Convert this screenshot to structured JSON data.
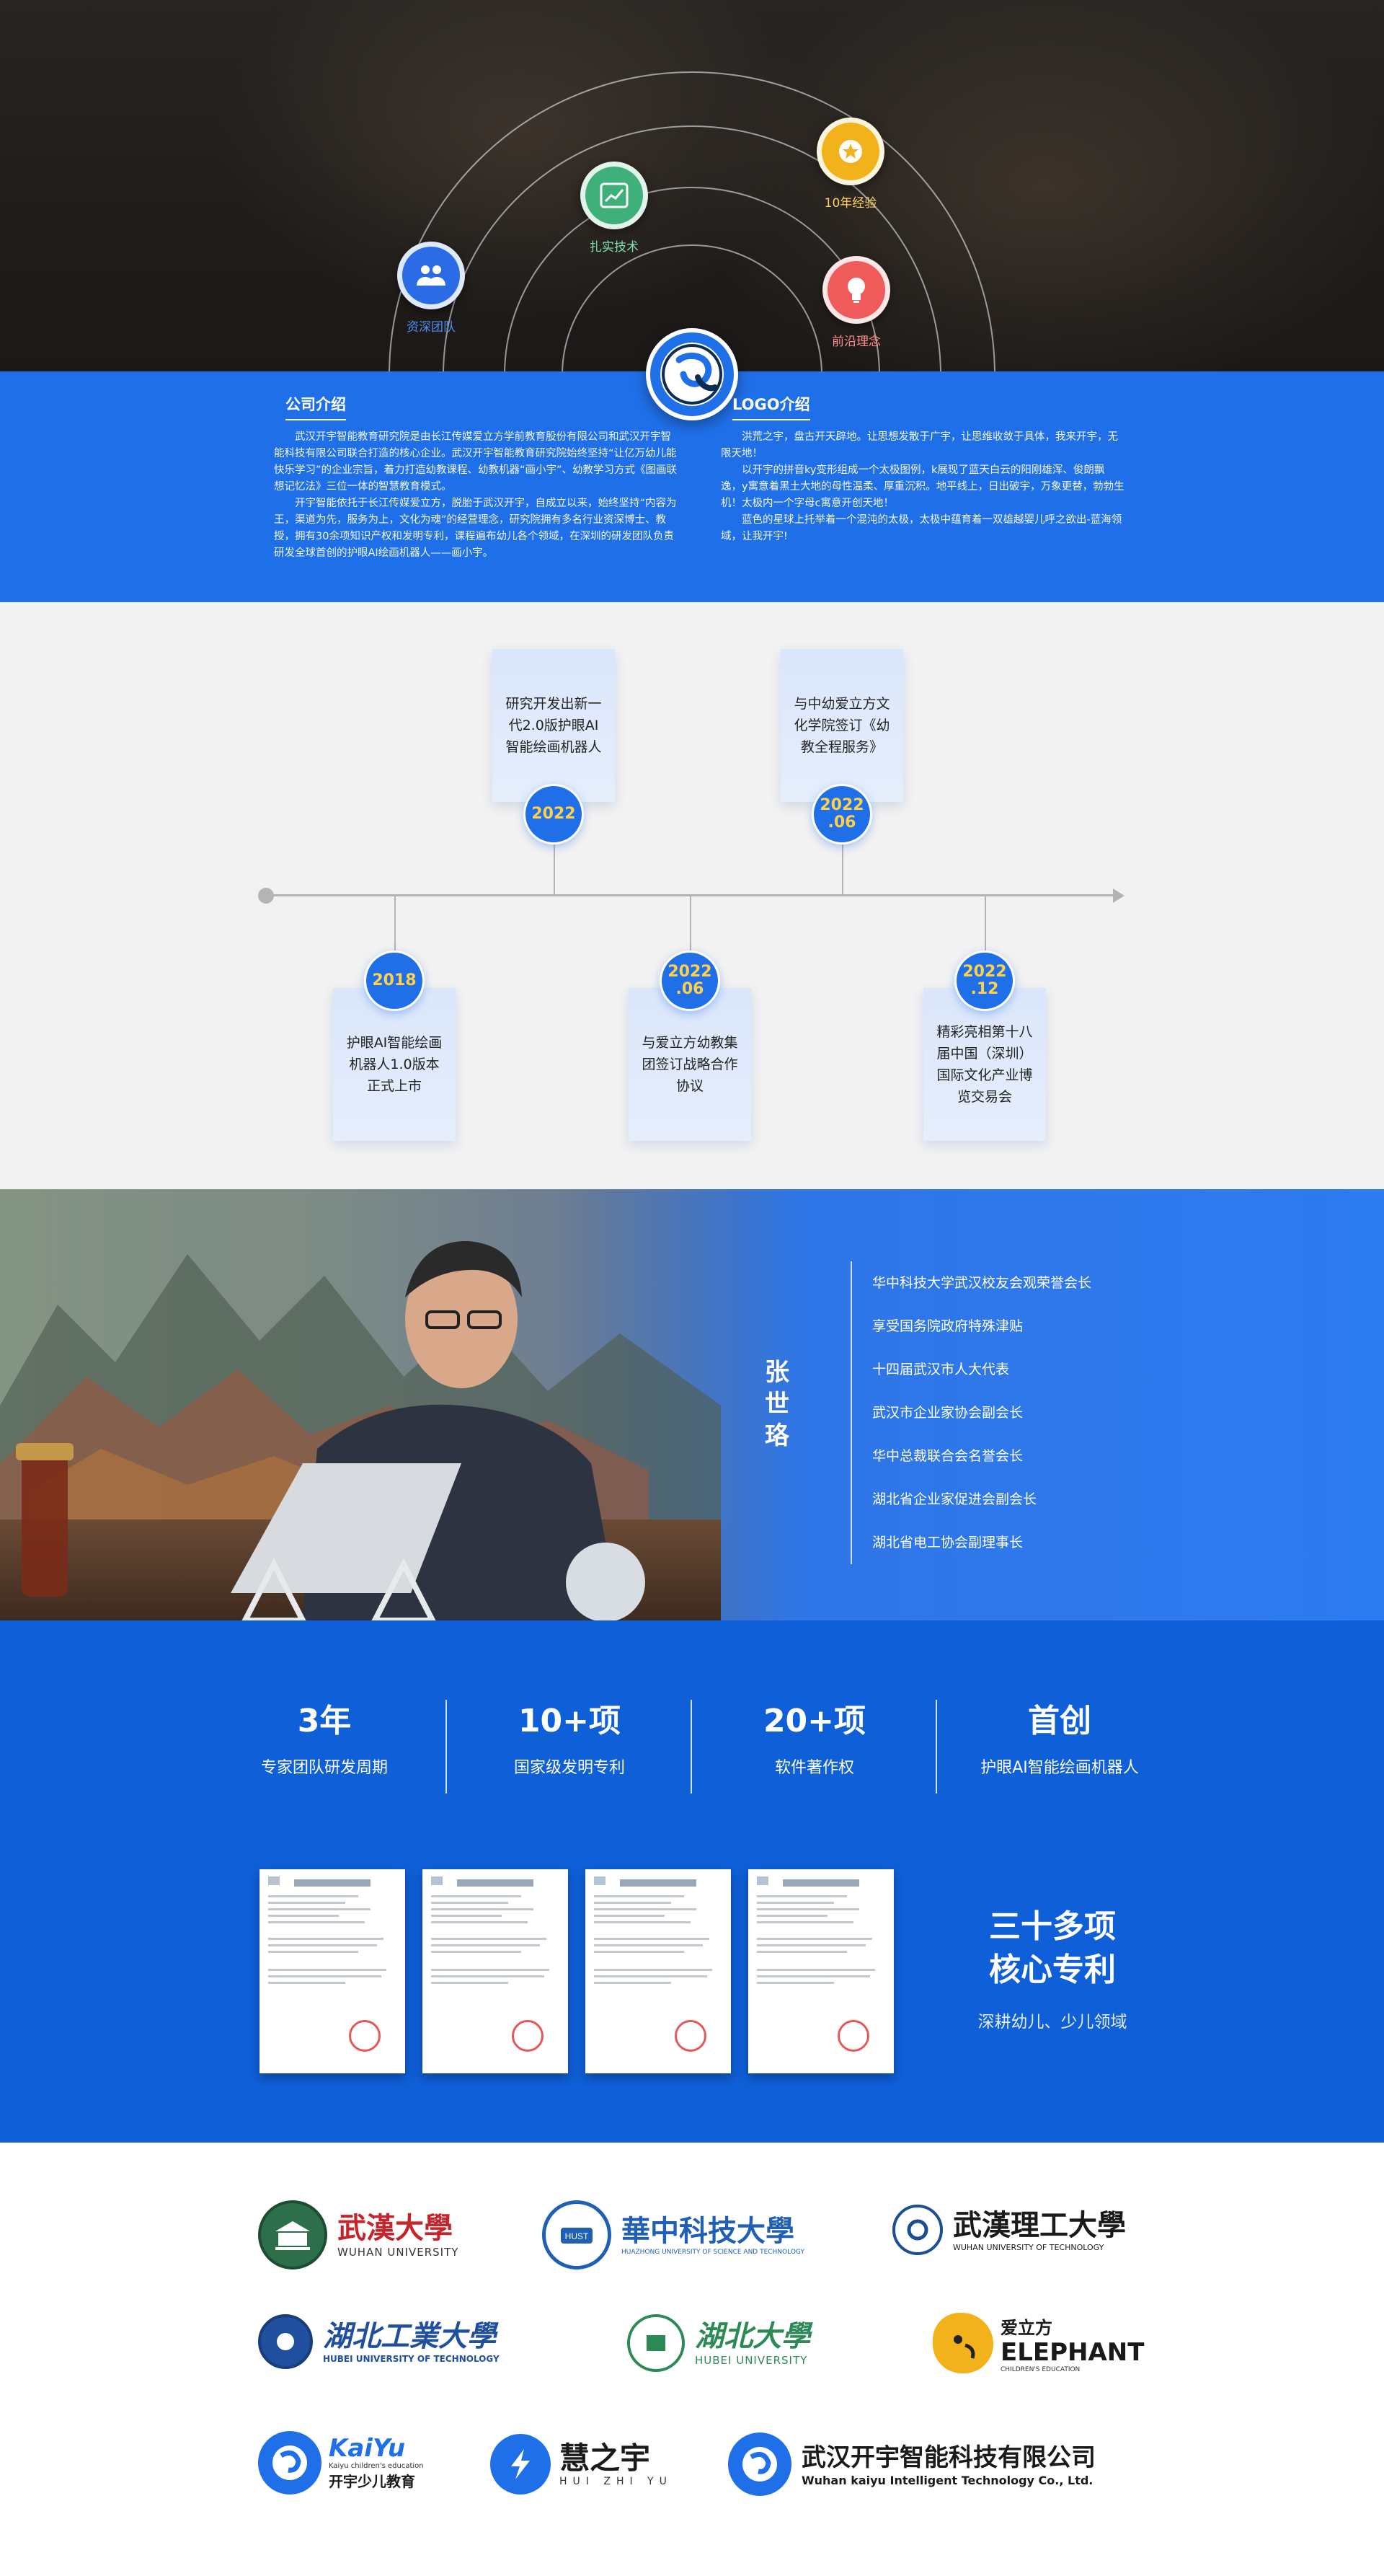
{
  "hero": {
    "features": [
      {
        "label": "资深团队",
        "icon": "team-icon"
      },
      {
        "label": "扎实技术",
        "icon": "chart-icon"
      },
      {
        "label": "10年经验",
        "icon": "star-medal-icon"
      },
      {
        "label": "前沿理念",
        "icon": "lightbulb-icon"
      }
    ]
  },
  "intro": {
    "company": {
      "title": "公司介绍",
      "p1": "武汉开宇智能教育研究院是由长江传媒爱立方学前教育股份有限公司和武汉开宇智能科技有限公司联合打造的核心企业。武汉开宇智能教育研究院始终坚持“让亿万幼儿能快乐学习”的企业宗旨，着力打造幼教课程、幼教机器“画小宇”、幼教学习方式《图画联想记忆法》三位一体的智慧教育模式。",
      "p2": "开宇智能依托于长江传媒爱立方，脱胎于武汉开宇，自成立以来，始终坚持“内容为王，渠道为先，服务为上，文化为魂”的经营理念，研究院拥有多名行业资深博士、教授，拥有30余项知识产权和发明专利，课程遍布幼儿各个领域，在深圳的研发团队负责研发全球首创的护眼AI绘画机器人——画小宇。"
    },
    "logo": {
      "title": "LOGO介绍",
      "p1": "洪荒之宇，盘古开天辟地。让思想发散于广宇，让思维收敛于具体，我来开宇，无限天地！",
      "p2": "以开宇的拼音ky变形组成一个太极图例，k展现了蓝天白云的阳刚雄浑、俊朗飘逸，y寓意着黑土大地的母性温柔、厚重沉积。地平线上，日出破宇，万象更替，勃勃生机！太极内一个字母c寓意开创天地！",
      "p3": "蓝色的星球上托举着一个混沌的太极，太极中蕴育着一双雄越婴儿呼之欲出-蓝海领域，让我开宇!"
    }
  },
  "timeline": {
    "events": [
      {
        "year": "2018",
        "year2": "",
        "text": "护眼AI智能绘画机器人1.0版本正式上市",
        "position": "below"
      },
      {
        "year": "2022",
        "year2": "",
        "text": "研究开发出新一代2.0版护眼AI智能绘画机器人",
        "position": "above"
      },
      {
        "year": "2022",
        "year2": ".06",
        "text": "与爱立方幼教集团签订战略合作协议",
        "position": "below"
      },
      {
        "year": "2022",
        "year2": ".06",
        "text": "与中幼爱立方文化学院签订《幼教全程服务》",
        "position": "above"
      },
      {
        "year": "2022",
        "year2": ".12",
        "text": "精彩亮相第十八届中国（深圳）国际文化产业博览交易会",
        "position": "below"
      }
    ]
  },
  "founder": {
    "name": "张世珞",
    "titles": [
      "华中科技大学武汉校友会观荣誉会长",
      "享受国务院政府特殊津贴",
      "十四届武汉市人大代表",
      "武汉市企业家协会副会长",
      "华中总裁联合会名誉会长",
      "湖北省企业家促进会副会长",
      "湖北省电工协会副理事长"
    ]
  },
  "stats": {
    "items": [
      {
        "num": "3年",
        "cap": "专家团队研发周期"
      },
      {
        "num": "10+项",
        "cap": "国家级发明专利"
      },
      {
        "num": "20+项",
        "cap": "软件著作权"
      },
      {
        "num": "首创",
        "cap": "护眼AI智能绘画机器人"
      }
    ],
    "patent_title_1": "三十多项",
    "patent_title_2": "核心专利",
    "patent_sub": "深耕幼儿、少儿领域"
  },
  "partners": {
    "items": [
      {
        "cn": "武漢大學",
        "en": "WUHAN UNIVERSITY"
      },
      {
        "cn": "華中科技大學",
        "en": "HUAZHONG UNIVERSITY OF SCIENCE AND TECHNOLOGY"
      },
      {
        "cn": "武漢理工大學",
        "en": "WUHAN UNIVERSITY OF TECHNOLOGY"
      },
      {
        "cn": "湖北工業大學",
        "en": "HUBEI UNIVERSITY OF TECHNOLOGY"
      },
      {
        "cn": "湖北大學",
        "en": "HUBEI UNIVERSITY"
      },
      {
        "cn": "爱立方",
        "en": "ELEPHANT",
        "en2": "CHILDREN'S EDUCATION"
      },
      {
        "cn": "KaiYu",
        "en": "Kaiyu children's education",
        "en2": "开宇少儿教育"
      },
      {
        "cn": "慧之宇",
        "en": "HUI ZHI YU"
      },
      {
        "cn": "武汉开宇智能科技有限公司",
        "en": "Wuhan kaiyu Intelligent Technology Co., Ltd."
      }
    ]
  },
  "colors": {
    "primary_blue": "#1f6fe8",
    "stats_blue": "#0f5fd8",
    "timeline_year": "#ffd04a",
    "timeline_bg": "#f2f2f2"
  }
}
